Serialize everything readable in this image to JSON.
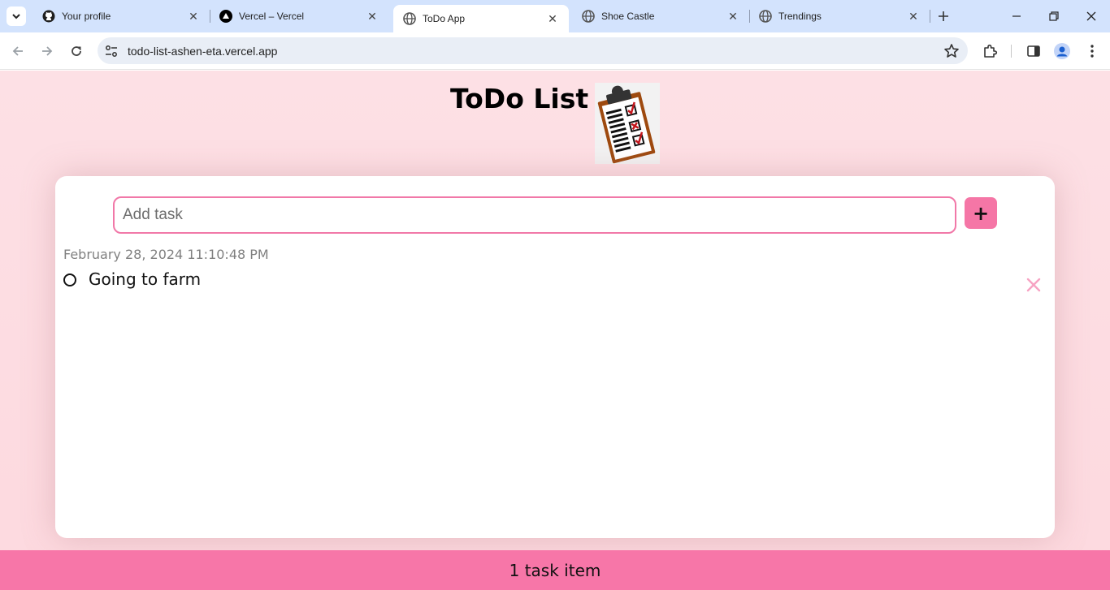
{
  "browser": {
    "tabs": [
      {
        "title": "Your profile",
        "icon": "github-icon"
      },
      {
        "title": "Vercel – Vercel",
        "icon": "vercel-icon"
      },
      {
        "title": "ToDo App",
        "icon": "globe-icon",
        "active": true
      },
      {
        "title": "Shoe Castle",
        "icon": "globe-icon"
      },
      {
        "title": "Trendings",
        "icon": "globe-icon"
      }
    ],
    "url": "todo-list-ashen-eta.vercel.app"
  },
  "app": {
    "title": "ToDo List",
    "input_placeholder": "Add task",
    "add_button_label": "+",
    "tasks": [
      {
        "date": "February 28, 2024 11:10:48 PM",
        "text": "Going to farm",
        "done": false
      }
    ],
    "footer_text": "1 task item"
  },
  "colors": {
    "accent": "#f776a8",
    "page_bg": "#fde0e5",
    "delete_icon": "#f7a3c3"
  }
}
